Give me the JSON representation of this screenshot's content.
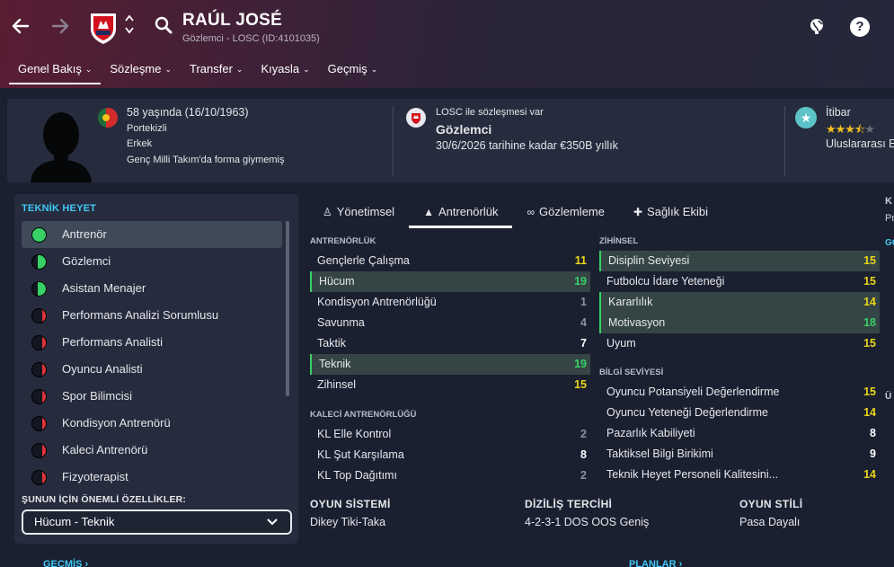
{
  "header": {
    "player_name": "RAÚL JOSÉ",
    "player_sub": "Gözlemci - LOSC (ID:4101035)",
    "help_label": "?"
  },
  "menu": [
    {
      "label": "Genel Bakış"
    },
    {
      "label": "Sözleşme"
    },
    {
      "label": "Transfer"
    },
    {
      "label": "Kıyasla"
    },
    {
      "label": "Geçmiş"
    }
  ],
  "profile": {
    "age": "58 yaşında (16/10/1963)",
    "nationality": "Portekizli",
    "gender": "Erkek",
    "youth_caps": "Genç Milli Takım'da forma giymemiş",
    "contract_line": "LOSC ile sözleşmesi var",
    "role": "Gözlemci",
    "contract_terms": "30/6/2026 tarihine kadar €350B yıllık",
    "reputation_label": "İtibar",
    "reputation_level": "Uluslararası E",
    "reputation_stars": 3.5
  },
  "staff": {
    "title": "TEKNİK HEYET",
    "items": [
      {
        "label": "Antrenör",
        "color": "#37d167",
        "fill": 1.0
      },
      {
        "label": "Gözlemci",
        "color": "#37d167",
        "fill": 0.6
      },
      {
        "label": "Asistan Menajer",
        "color": "#37d167",
        "fill": 0.6
      },
      {
        "label": "Performans Analizi Sorumlusu",
        "color": "#e0333b",
        "fill": 0.3
      },
      {
        "label": "Performans Analisti",
        "color": "#e0333b",
        "fill": 0.3
      },
      {
        "label": "Oyuncu Analisti",
        "color": "#e0333b",
        "fill": 0.3
      },
      {
        "label": "Spor Bilimcisi",
        "color": "#e0333b",
        "fill": 0.3
      },
      {
        "label": "Kondisyon Antrenörü",
        "color": "#e0333b",
        "fill": 0.3
      },
      {
        "label": "Kaleci Antrenörü",
        "color": "#e0333b",
        "fill": 0.3
      },
      {
        "label": "Fizyoterapist",
        "color": "#e0333b",
        "fill": 0.3
      }
    ],
    "key_attrs_title": "ŞUNUN İÇİN ÖNEMLİ ÖZELLİKLER:",
    "key_attrs_value": "Hücum - Teknik"
  },
  "tabs": [
    {
      "label": "Yönetimsel",
      "icon": "person-icon"
    },
    {
      "label": "Antrenörlük",
      "icon": "cone-icon"
    },
    {
      "label": "Gözlemleme",
      "icon": "binoculars-icon"
    },
    {
      "label": "Sağlık Ekibi",
      "icon": "medical-kit-icon"
    }
  ],
  "coaching": {
    "title": "ANTRENÖRLÜK",
    "rows": [
      {
        "label": "Gençlerle Çalışma",
        "value": "11",
        "tone": "yellow",
        "hl": false
      },
      {
        "label": "Hücum",
        "value": "19",
        "tone": "green",
        "hl": true
      },
      {
        "label": "Kondisyon Antrenörlüğü",
        "value": "1",
        "tone": "grey",
        "hl": false
      },
      {
        "label": "Savunma",
        "value": "4",
        "tone": "grey",
        "hl": false
      },
      {
        "label": "Taktik",
        "value": "7",
        "tone": "white",
        "hl": false
      },
      {
        "label": "Teknik",
        "value": "19",
        "tone": "green",
        "hl": true
      },
      {
        "label": "Zihinsel",
        "value": "15",
        "tone": "yellow",
        "hl": false
      }
    ]
  },
  "gk_coaching": {
    "title": "KALECİ ANTRENÖRLÜĞÜ",
    "rows": [
      {
        "label": "KL Elle Kontrol",
        "value": "2",
        "tone": "grey",
        "hl": false
      },
      {
        "label": "KL Şut Karşılama",
        "value": "8",
        "tone": "white",
        "hl": false
      },
      {
        "label": "KL Top Dağıtımı",
        "value": "2",
        "tone": "grey",
        "hl": false
      }
    ]
  },
  "mental": {
    "title": "ZİHİNSEL",
    "rows": [
      {
        "label": "Disiplin Seviyesi",
        "value": "15",
        "tone": "yellow",
        "hl": true
      },
      {
        "label": "Futbolcu İdare Yeteneği",
        "value": "15",
        "tone": "yellow",
        "hl": false
      },
      {
        "label": "Kararlılık",
        "value": "14",
        "tone": "yellow",
        "hl": true
      },
      {
        "label": "Motivasyon",
        "value": "18",
        "tone": "green",
        "hl": true
      },
      {
        "label": "Uyum",
        "value": "15",
        "tone": "yellow",
        "hl": false
      }
    ]
  },
  "knowledge": {
    "title": "BİLGİ SEVİYESİ",
    "rows": [
      {
        "label": "Oyuncu Potansiyeli Değerlendirme",
        "value": "15",
        "tone": "yellow",
        "hl": false
      },
      {
        "label": "Oyuncu Yeteneği Değerlendirme",
        "value": "14",
        "tone": "yellow",
        "hl": false
      },
      {
        "label": "Pazarlık Kabiliyeti",
        "value": "8",
        "tone": "white",
        "hl": false
      },
      {
        "label": "Taktiksel Bilgi Birikimi",
        "value": "9",
        "tone": "white",
        "hl": false
      },
      {
        "label": "Teknik Heyet Personeli Kalitesini...",
        "value": "14",
        "tone": "yellow",
        "hl": false
      }
    ]
  },
  "tactics": {
    "system_label": "OYUN SİSTEMİ",
    "system_value": "Dikey Tiki-Taka",
    "formation_label": "DİZİLİŞ TERCİHİ",
    "formation_value": "4-2-3-1 DOS OOS Geniş",
    "style_label": "OYUN STİLİ",
    "style_value": "Pasa Dayalı"
  },
  "bottom": {
    "history": "GEÇMİŞ ›",
    "plans": "PLANLAR ›"
  },
  "edge": {
    "a": "K",
    "b": "Pr",
    "c": "GÖ",
    "d": "Ü"
  }
}
